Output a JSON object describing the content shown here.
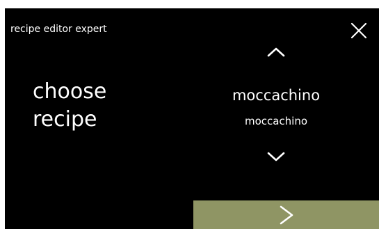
{
  "header": {
    "title": "recipe editor expert",
    "close_icon": "close-x-icon"
  },
  "prompt": {
    "line1": "choose",
    "line2": "recipe"
  },
  "recipe_selector": {
    "up_icon": "chevron-up-icon",
    "selected_name": "moccachino",
    "selected_subname": "moccachino",
    "down_icon": "chevron-down-icon"
  },
  "footer": {
    "next_icon": "chevron-right-icon"
  },
  "colors": {
    "screen_background": "#000000",
    "text": "#ffffff",
    "next_button": "#8f9564"
  }
}
